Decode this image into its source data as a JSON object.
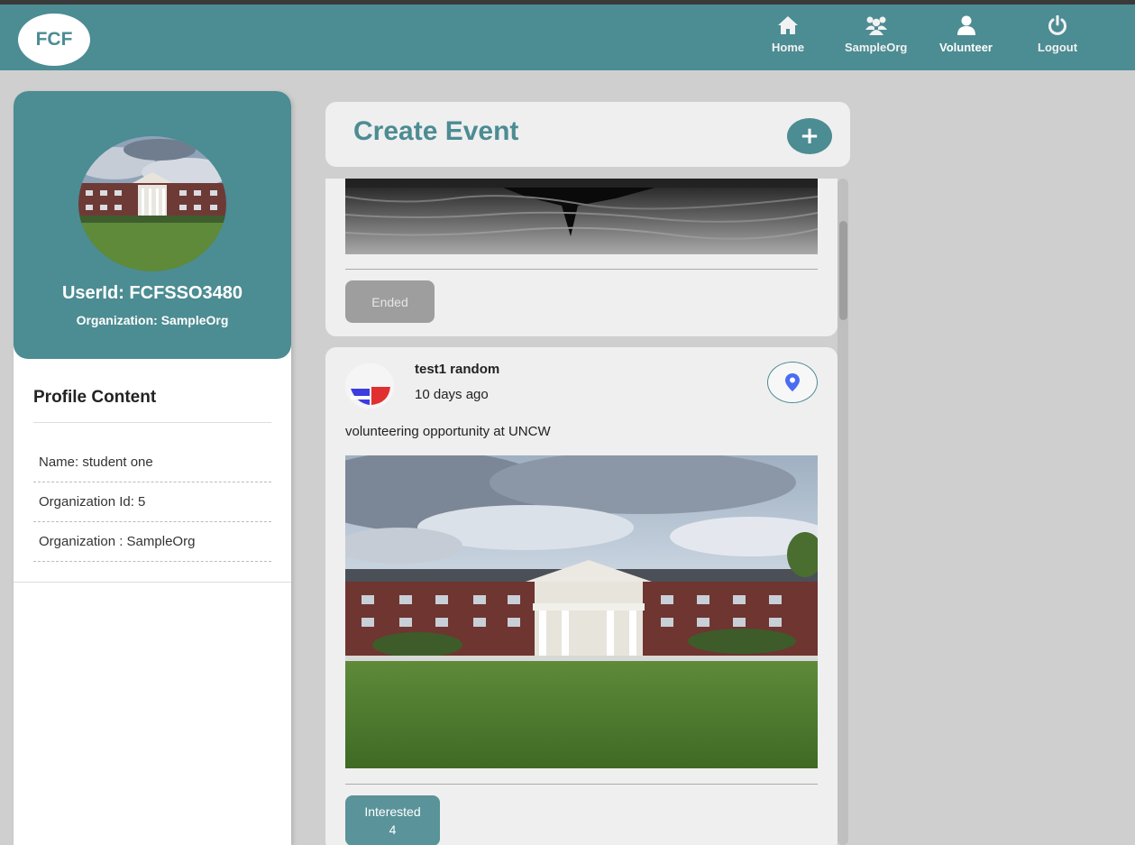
{
  "brand": {
    "logo_text": "FCF",
    "primary_color": "#4c8c93"
  },
  "nav": {
    "items": [
      {
        "label": "Home",
        "icon": "home-icon"
      },
      {
        "label": "SampleOrg",
        "icon": "group-icon"
      },
      {
        "label": "Volunteer",
        "icon": "user-icon",
        "active": true
      },
      {
        "label": "Logout",
        "icon": "power-icon"
      }
    ]
  },
  "profile": {
    "user_id": "UserId: FCFSSO3480",
    "organization": "Organization: SampleOrg",
    "content_title": "Profile Content",
    "details": [
      "Name: student one",
      "Organization Id: 5",
      "Organization : SampleOrg"
    ]
  },
  "create_event": {
    "title": "Create Event",
    "button_icon": "plus-icon"
  },
  "feed": {
    "posts": [
      {
        "status_button": "Ended"
      },
      {
        "author": "test1 random",
        "time": "10 days ago",
        "description": "volunteering opportunity at UNCW",
        "location_icon": "map-pin-icon",
        "interested_label": "Interested",
        "interested_count": "4"
      }
    ]
  }
}
